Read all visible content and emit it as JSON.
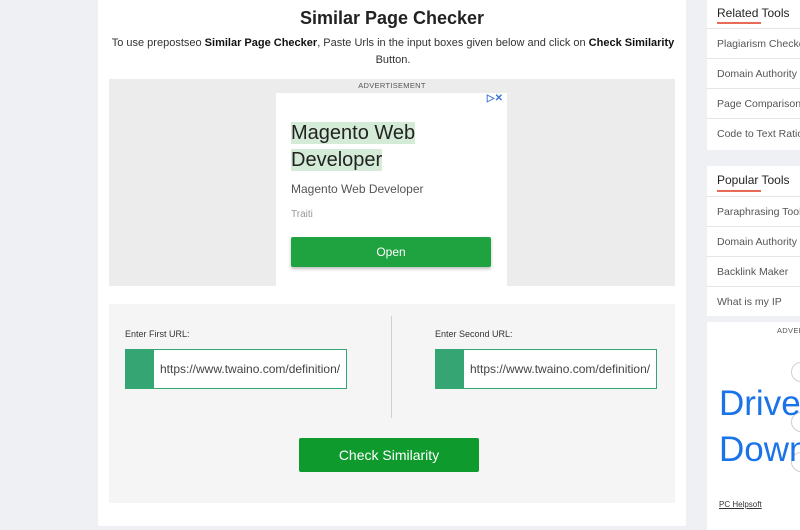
{
  "page": {
    "title": "Similar Page Checker",
    "intro_prefix": "To use prepostseo ",
    "intro_bold_1": "Similar Page Checker",
    "intro_middle": ", Paste Urls in the input boxes given below and click on ",
    "intro_bold_2": "Check Similarity",
    "intro_suffix": " Button."
  },
  "ad": {
    "label": "ADVERTISEMENT",
    "icons": "▷✕",
    "headline": "Magento Web Developer",
    "description": "Magento Web Developer",
    "sponsor": "Traiti",
    "cta": "Open"
  },
  "form": {
    "first_label": "Enter First URL:",
    "first_value": "https://www.twaino.com/definition/s/similar-page-checker/",
    "second_label": "Enter Second URL:",
    "second_value": "https://www.twaino.com/definition/s/similar-page-checker/",
    "submit": "Check Similarity"
  },
  "sidebar": {
    "related": {
      "title": "Related Tools",
      "items": [
        "Plagiarism Checker",
        "Domain Authority",
        "Page Comparison",
        "Code to Text Ratio"
      ]
    },
    "popular": {
      "title": "Popular Tools",
      "items": [
        "Paraphrasing Tool",
        "Domain Authority",
        "Backlink Maker",
        "What is my IP"
      ]
    },
    "ad": {
      "label": "ADVERTISEMENT",
      "line1": "Drive",
      "line2": "Down",
      "brand": "PC Helpsoft"
    }
  },
  "colors": {
    "accent_green": "#35a673",
    "button_green": "#0f9a2e",
    "underline": "#e86a58",
    "ad_blue": "#1a73e8"
  }
}
